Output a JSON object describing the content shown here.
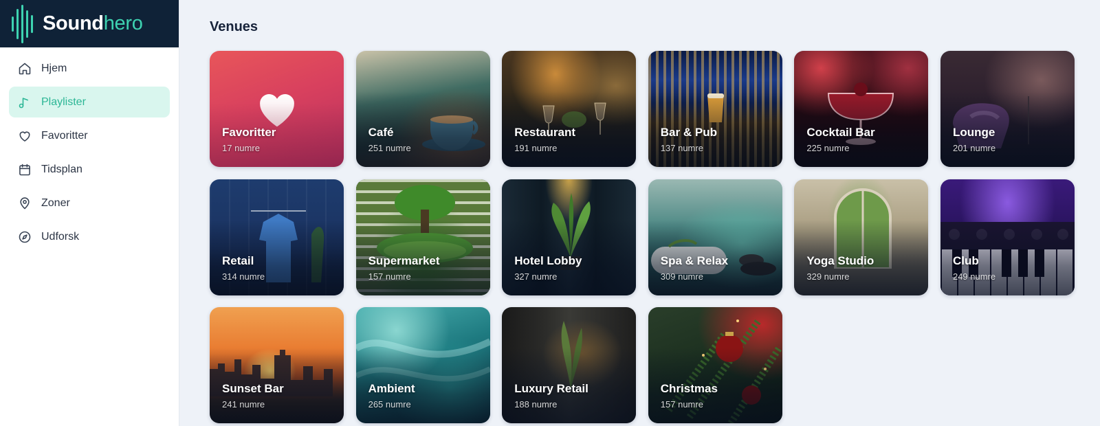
{
  "brand": {
    "part1": "Sound",
    "part2": "hero"
  },
  "nav": [
    {
      "label": "Hjem",
      "icon": "home-icon",
      "active": false
    },
    {
      "label": "Playlister",
      "icon": "music-note-icon",
      "active": true
    },
    {
      "label": "Favoritter",
      "icon": "heart-icon",
      "active": false
    },
    {
      "label": "Tidsplan",
      "icon": "calendar-icon",
      "active": false
    },
    {
      "label": "Zoner",
      "icon": "map-pin-icon",
      "active": false
    },
    {
      "label": "Udforsk",
      "icon": "compass-icon",
      "active": false
    }
  ],
  "page": {
    "title": "Venues"
  },
  "venues": [
    {
      "title": "Favoritter",
      "count": "17 numre"
    },
    {
      "title": "Café",
      "count": "251 numre"
    },
    {
      "title": "Restaurant",
      "count": "191 numre"
    },
    {
      "title": "Bar & Pub",
      "count": "137 numre"
    },
    {
      "title": "Cocktail Bar",
      "count": "225 numre"
    },
    {
      "title": "Lounge",
      "count": "201 numre"
    },
    {
      "title": "Retail",
      "count": "314 numre"
    },
    {
      "title": "Supermarket",
      "count": "157 numre"
    },
    {
      "title": "Hotel Lobby",
      "count": "327 numre"
    },
    {
      "title": "Spa & Relax",
      "count": "309 numre"
    },
    {
      "title": "Yoga Studio",
      "count": "329 numre"
    },
    {
      "title": "Club",
      "count": "249 numre"
    },
    {
      "title": "Sunset Bar",
      "count": "241 numre"
    },
    {
      "title": "Ambient",
      "count": "265 numre"
    },
    {
      "title": "Luxury Retail",
      "count": "188 numre"
    },
    {
      "title": "Christmas",
      "count": "157 numre"
    }
  ],
  "colors": {
    "accent": "#3ed3b1",
    "brand_bg": "#0f2237",
    "active_bg": "#d9f6ee",
    "active_text": "#2bb695"
  }
}
